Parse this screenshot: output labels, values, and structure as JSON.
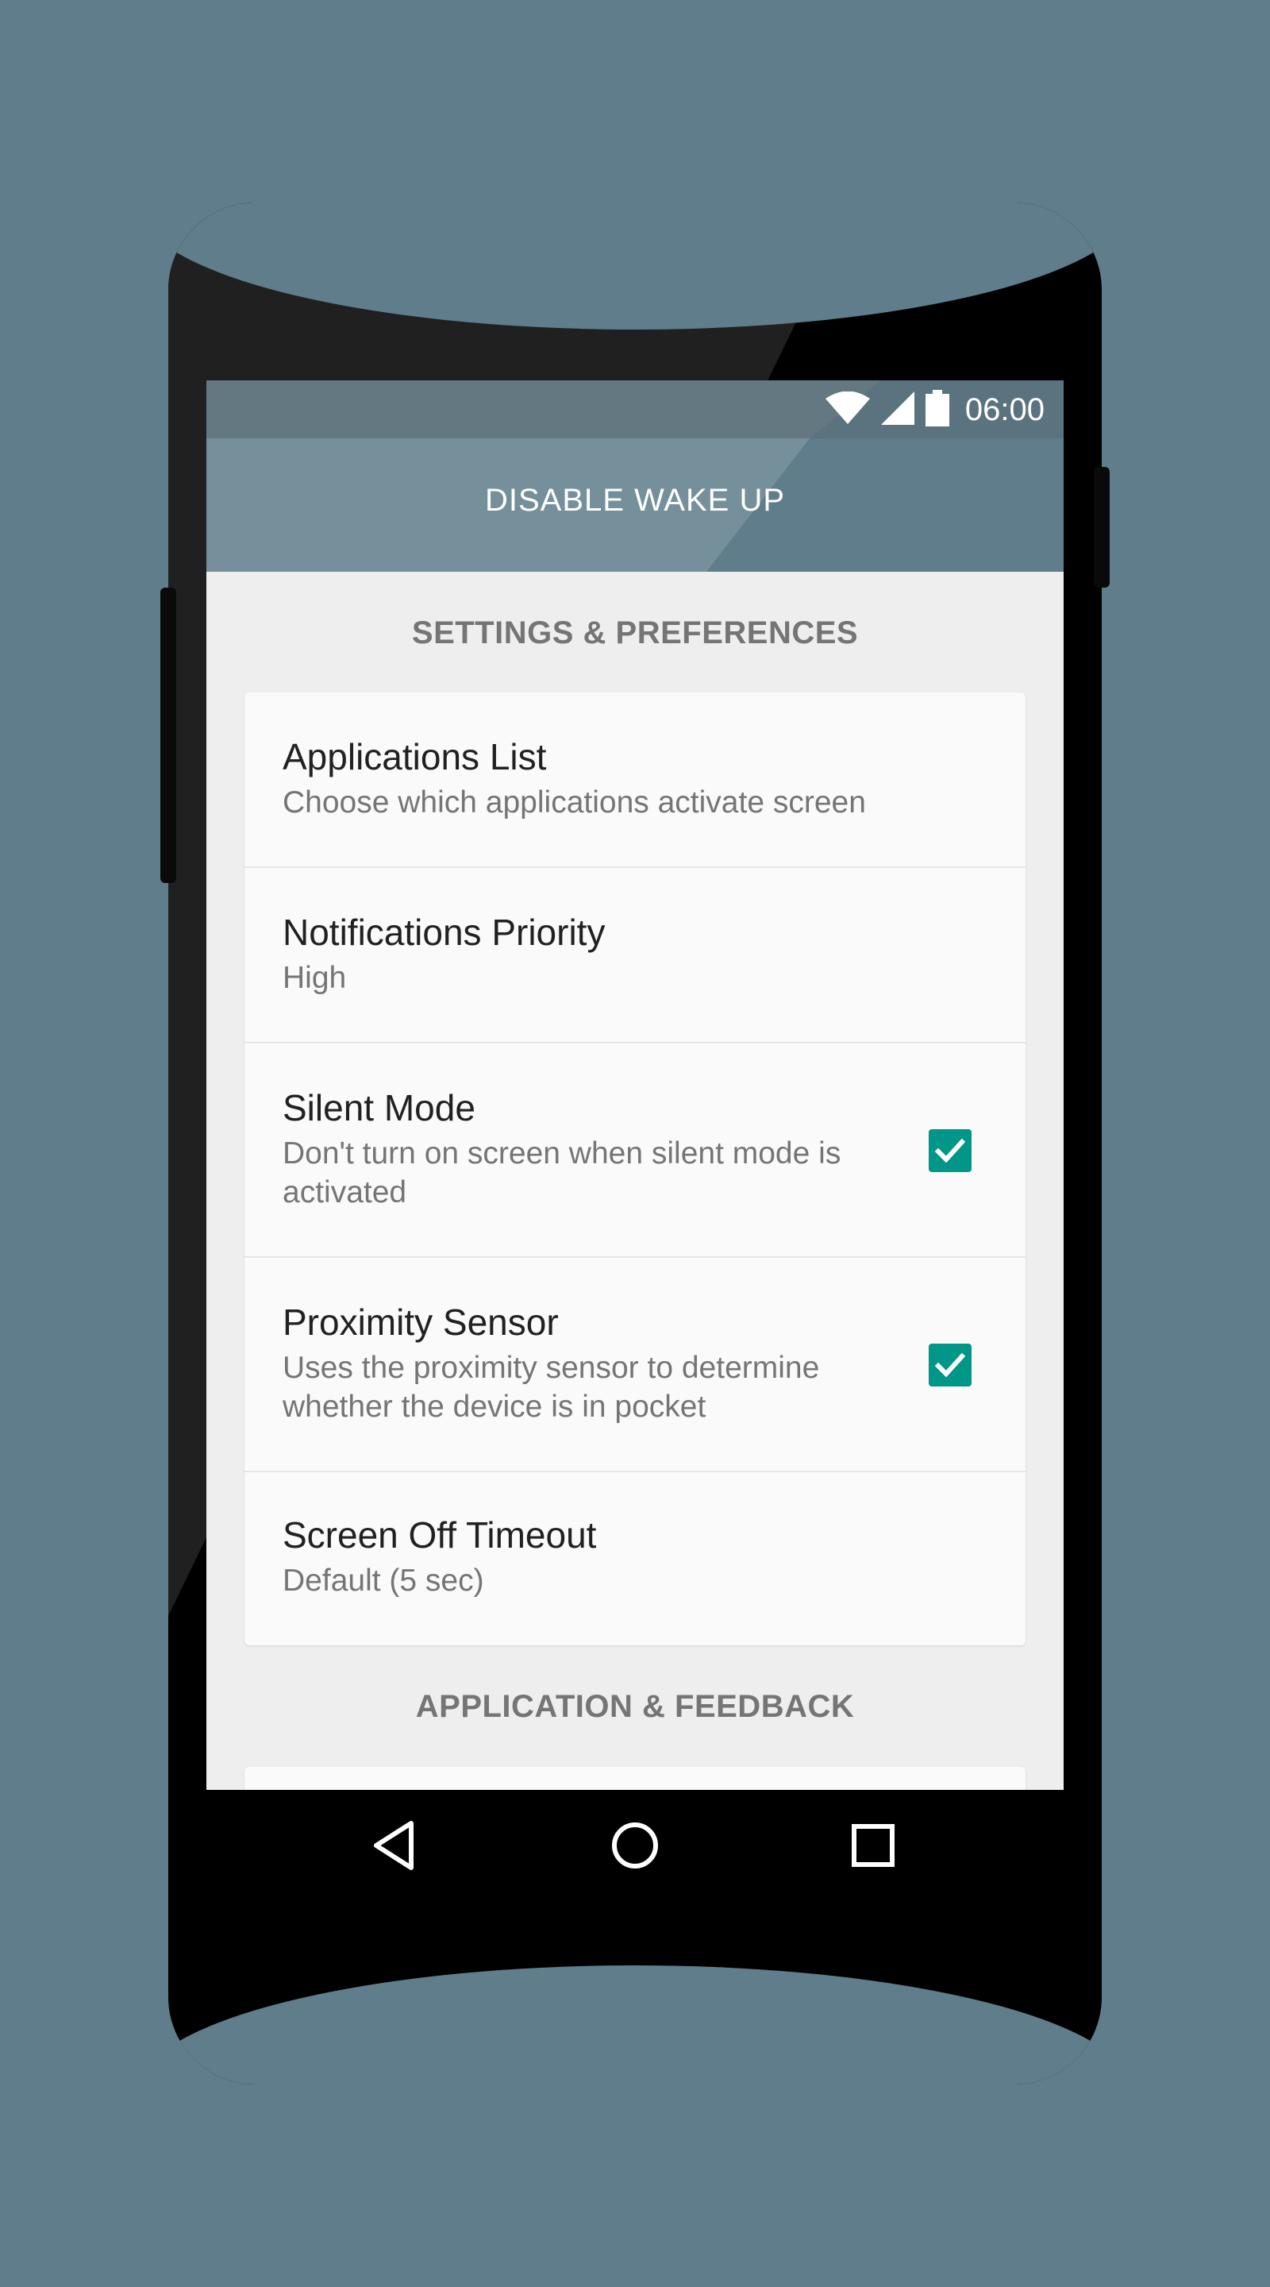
{
  "status_bar": {
    "time": "06:00",
    "icons": [
      "wifi-icon",
      "signal-icon",
      "battery-icon"
    ]
  },
  "app_bar": {
    "title": "DISABLE WAKE UP"
  },
  "sections": [
    {
      "header": "SETTINGS & PREFERENCES",
      "items": [
        {
          "title": "Applications List",
          "summary": "Choose which applications activate screen"
        },
        {
          "title": "Notifications Priority",
          "summary": "High"
        },
        {
          "title": "Silent Mode",
          "summary": "Don't turn on screen when silent mode is activated",
          "checked": true
        },
        {
          "title": "Proximity Sensor",
          "summary": "Uses the proximity sensor to determine whether the device is in pocket",
          "checked": true
        },
        {
          "title": "Screen Off Timeout",
          "summary": "Default (5 sec)"
        }
      ]
    },
    {
      "header": "APPLICATION & FEEDBACK",
      "items": []
    }
  ],
  "nav_bar": {
    "buttons": [
      "back-icon",
      "home-icon",
      "recents-icon"
    ]
  },
  "colors": {
    "background": "#607d8b",
    "app_bar": "#607d8b",
    "accent": "#009688"
  }
}
